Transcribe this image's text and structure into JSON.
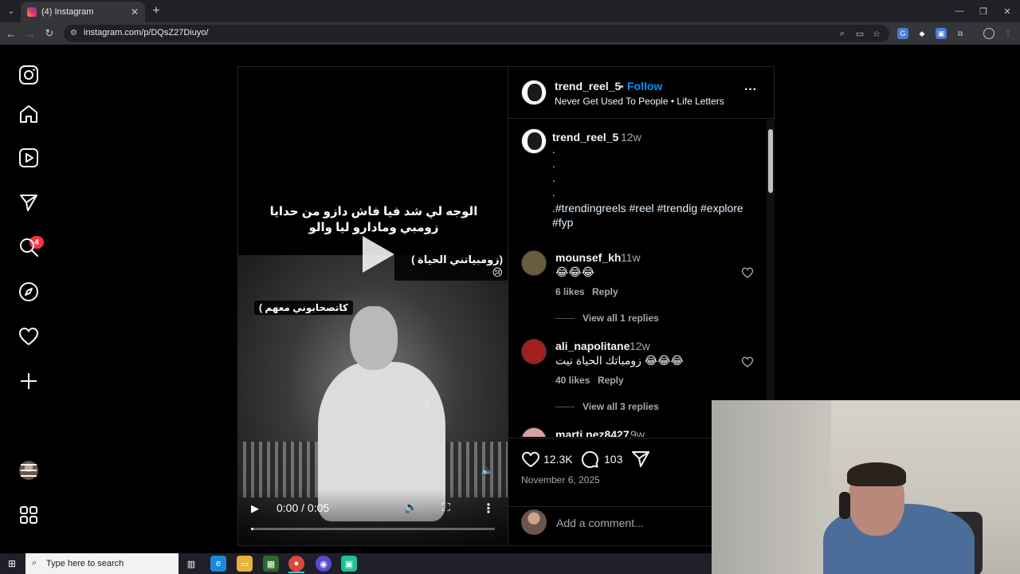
{
  "browser": {
    "tab_title": "(4) Instagram",
    "url": "instagram.com/p/DQsZ27Diuyo/",
    "icons": [
      "tab-list-icon",
      "close-tab-icon",
      "new-tab-icon",
      "minimize-icon",
      "restore-icon",
      "close-window-icon",
      "back-icon",
      "forward-icon",
      "reload-icon",
      "site-info-icon",
      "zoom-icon",
      "cast-icon",
      "bookmark-star-icon",
      "translate-extension-icon",
      "extension-icon",
      "extensions-puzzle-icon",
      "profile-icon",
      "menu-kebab-icon"
    ]
  },
  "nav": {
    "items": [
      "instagram-logo",
      "home",
      "reels",
      "notifications",
      "search",
      "explore",
      "likes",
      "create",
      "profile",
      "more",
      "also-from-meta"
    ],
    "notification_count": "4"
  },
  "video": {
    "caption_main": "الوجه لي شد فيا فاش دازو من حدايا زومبي ومادارو ليا والو",
    "caption_zombie": "(زومبياتني الحياة ) 😢",
    "caption_side": "كاتصحابوني معهم )",
    "time": "0:00 / 0:05",
    "progress_fraction": 0.0
  },
  "post": {
    "username": "trend_reel_5",
    "follow_label": "Follow",
    "separator": "•",
    "audio": "Never Get Used To People • Life Letters",
    "caption": {
      "username": "trend_reel_5",
      "time": "12w",
      "dots": [
        ".",
        ".",
        ".",
        "."
      ],
      "hashtags_line1": ".#trendingreels #reel #trendig #explore",
      "hashtags_line2": "#fyp"
    },
    "comments": [
      {
        "username": "mounsef_kh",
        "time": "11w",
        "text": "😂😂😂",
        "likes": "6 likes",
        "reply": "Reply",
        "view_replies": "View all 1 replies"
      },
      {
        "username": "ali_napolitane",
        "time": "12w",
        "text": "زومباتك الحياة نيت 😂😂😂",
        "likes": "40 likes",
        "reply": "Reply",
        "view_replies": "View all 3 replies"
      },
      {
        "username": "marti.nez8427",
        "time": "9w"
      }
    ],
    "likes_count": "12.3K",
    "comments_count": "103",
    "date": "November 6, 2025",
    "add_comment_placeholder": "Add a comment..."
  },
  "taskbar": {
    "search_placeholder": "Type here to search"
  },
  "colors": {
    "link_blue": "#0095f6",
    "badge_red": "#ff3040",
    "border": "#262626",
    "muted": "#a8a8a8"
  }
}
